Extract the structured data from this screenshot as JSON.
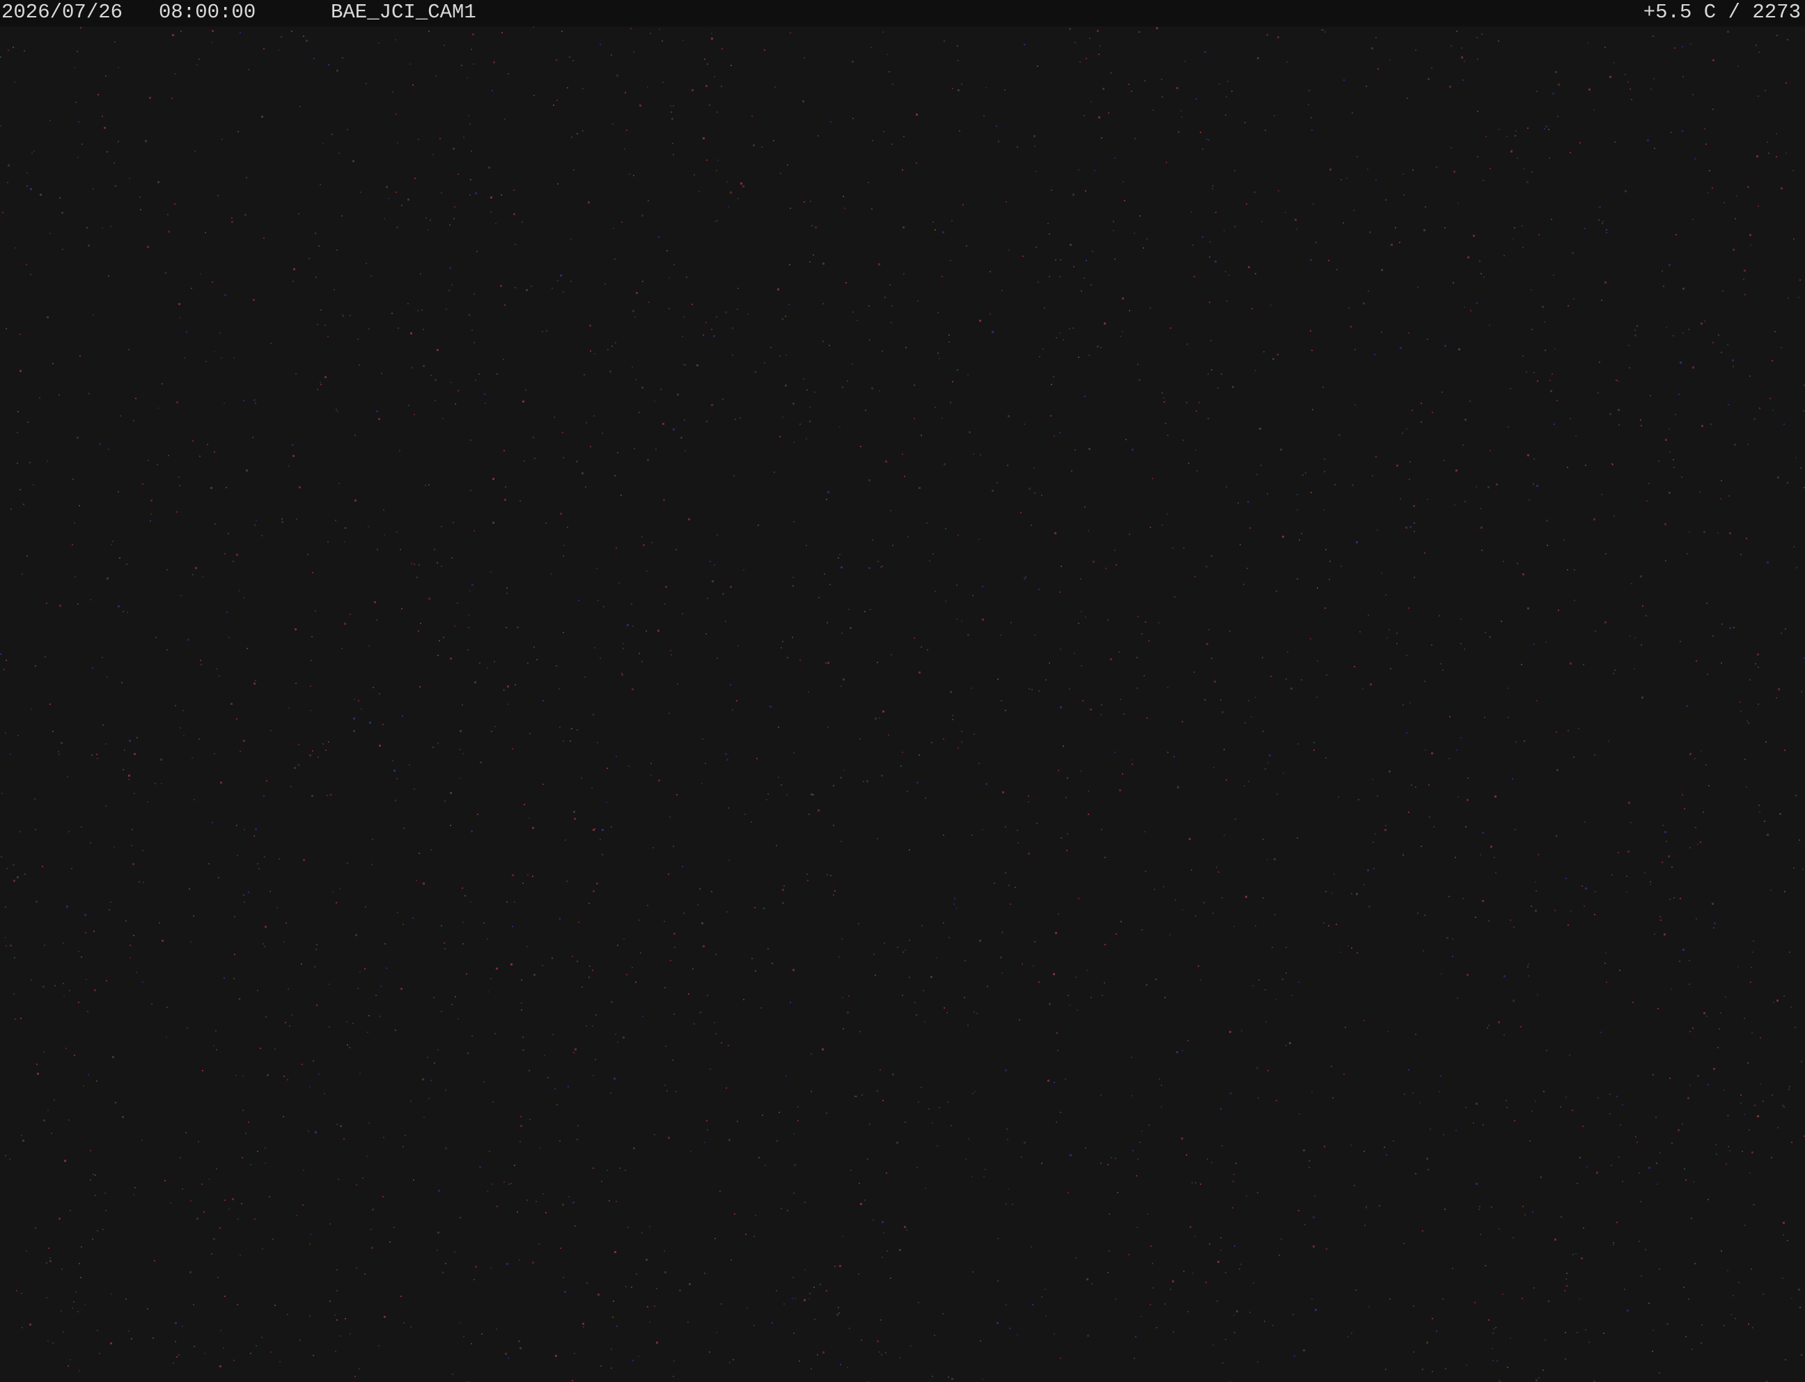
{
  "overlay": {
    "date": "2026/07/26",
    "time": "08:00:00",
    "camera_id": "BAE_JCI_CAM1",
    "temperature_reading": "+5.5 C / 2273"
  },
  "colors": {
    "background": "#151515",
    "overlay_bar": "#0f0f0f",
    "overlay_text": "#d8d8d8",
    "noise_red": "#8a2a3a",
    "noise_green": "#2f4a35",
    "noise_blue": "#2b2f7a",
    "noise_grey": "#3a3a3a"
  }
}
